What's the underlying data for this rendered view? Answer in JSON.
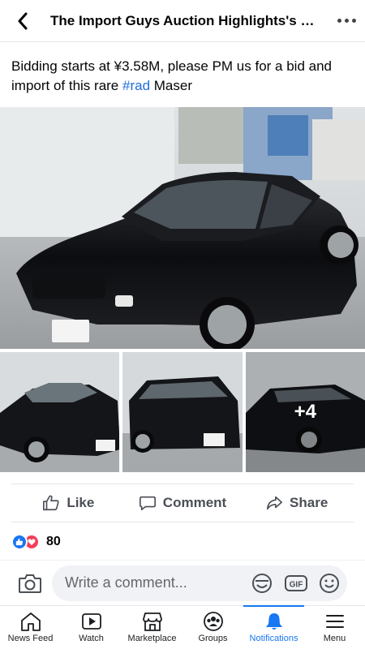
{
  "header": {
    "title": "The Import Guys Auction Highlights's p...",
    "back_icon": "chevron-left-icon",
    "more_icon": "more-horizontal-icon"
  },
  "post": {
    "text_before": "Bidding starts at ¥3.58M, please PM us for a bid and import of this rare ",
    "hashtag": "#rad",
    "text_after": " Maser",
    "more_photos_label": "+4"
  },
  "actions": {
    "like": "Like",
    "comment": "Comment",
    "share": "Share"
  },
  "reactions": {
    "count": "80",
    "types": [
      "like",
      "love"
    ]
  },
  "comment_bar": {
    "placeholder": "Write a comment...",
    "camera_icon": "camera-icon",
    "sticker_icon": "sticker-icon",
    "gif_label": "GIF",
    "emoji_icon": "emoji-icon"
  },
  "nav": {
    "items": [
      {
        "label": "News Feed",
        "icon": "home-icon"
      },
      {
        "label": "Watch",
        "icon": "watch-icon"
      },
      {
        "label": "Marketplace",
        "icon": "marketplace-icon"
      },
      {
        "label": "Groups",
        "icon": "groups-icon"
      },
      {
        "label": "Notifications",
        "icon": "bell-icon",
        "active": true
      },
      {
        "label": "Menu",
        "icon": "menu-icon"
      }
    ]
  },
  "colors": {
    "accent": "#1877f2",
    "hashtag": "#216fdb",
    "love": "#f33e58"
  }
}
